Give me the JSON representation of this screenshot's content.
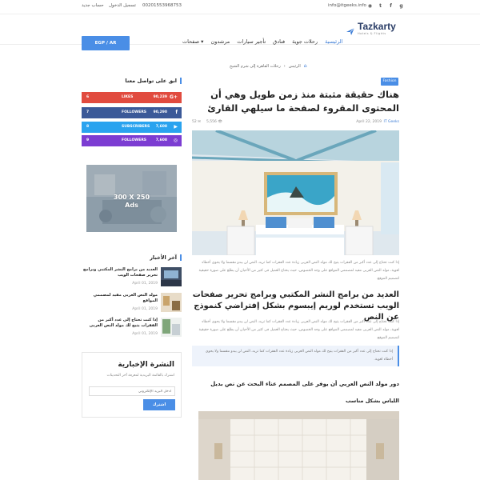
{
  "topbar": {
    "email": "info@itgeeks.info",
    "phone": "00201553968753",
    "login": "تسجيل الدخول",
    "register": "حساب جديد",
    "social_icons": [
      "instagram-icon",
      "twitter-icon",
      "facebook-icon",
      "google-plus-icon"
    ]
  },
  "header": {
    "logo_text": "Tazkarty",
    "logo_sub": "Hotels & Flights",
    "nav": [
      {
        "label": "الرئيسية",
        "active": true
      },
      {
        "label": "رحلات جوية",
        "active": false
      },
      {
        "label": "فنادق",
        "active": false
      },
      {
        "label": "تأجير سيارات",
        "active": false
      },
      {
        "label": "مرشدون",
        "active": false
      },
      {
        "label": "صفحات ▾",
        "active": false
      }
    ],
    "currency_button": "EGP / AR"
  },
  "breadcrumb": {
    "items": [
      "الرئيس",
      "رحلات القاهرة إلى شرم الشيخ"
    ]
  },
  "article": {
    "tag": "Fashion",
    "title": "هناك حقيقة مثبتة منذ زمن طويل وهي أن المحتوى المقروء لصفحة ما سيلهي القارئ",
    "author": "IT Geeks",
    "date": "April 22, 2019",
    "views": "5,556",
    "comments": "52",
    "para1": "إذا كنت تحتاج إلى عدد أكبر من الفقرات يتيح لك مولد النص العربى زيادة عدد الفقرات كما تريد، النص لن يبدو مقسما ولا يحوي أخطاء لغوية، مولد النص العربى مفيد لمصممي المواقع على وجه الخصوص، حيث يحتاج العميل فى كثير من الأحيان أن يطلع على صورة حقيقية لتصميم الموقع.",
    "subtitle": "العديد من برامج النشر المكتبي وبرامج تحرير صفحات الويب تستخدم لوريم إيبسوم بشكل إفتراضي كنموذج عن النص",
    "para2": "إذا كنت تحتاج إلى عدد أكبر من الفقرات يتيح لك مولد النص العربى زيادة عدد الفقرات كما تريد، النص لن يبدو مقسما ولا يحوي أخطاء لغوية، مولد النص العربى مفيد لمصممي المواقع على وجه الخصوص، حيث يحتاج العميل فى كثير من الأحيان أن يطلع على صورة حقيقية لتصميم الموقع.",
    "quote": "إذا كنت تحتاج إلى عدد أكبر من الفقرات يتيح لك مولد النص العربى زيادة عدد الفقرات كما تريد، النص لن يبدو مقسما ولا يحوي أخطاء لغوية.",
    "heading3": "دور مولد النص العربي أن يوفر على المصمم عناء البحث عن نص بديل",
    "heading4": "اللباس بشكل مناسب"
  },
  "sidebar": {
    "social_title": "ابق على تواصل معنا",
    "social": [
      {
        "icon": "G+",
        "count": "90,239",
        "label": "LIKES",
        "num": "6"
      },
      {
        "icon": "f",
        "count": "90,290",
        "label": "FOLLOWERS",
        "num": "7"
      },
      {
        "icon": "▶",
        "count": "7,608",
        "label": "SUBSCRIBERS",
        "num": "8"
      },
      {
        "icon": "◎",
        "count": "7,608",
        "label": "FOLLOWERS",
        "num": "9"
      }
    ],
    "ad_label": "300 X 250",
    "ad_sub": "Ads",
    "latest_title": "آخر الأخبار",
    "latest": [
      {
        "title": "العديد من برامج النشر المكتبي وبرامج تحرير صفحات الويب",
        "date": "April 01, 2019"
      },
      {
        "title": "مولد النص العربى مفيد لمصممي المواقع",
        "date": "April 01, 2019"
      },
      {
        "title": "إذا كنت تحتاج إلى عدد أكبر من الفقرات يتيح لك مولد النص العربى",
        "date": "April 01, 2019"
      }
    ],
    "newsletter": {
      "title": "النشرة الإخبارية",
      "desc": "اشترك بالقائمة البريدية لمعرفة آخر التحديثات",
      "placeholder": "ادخل البريد الإلكتروني",
      "button": "اشترك"
    }
  },
  "colors": {
    "accent": "#4a8ee6",
    "google": "#e14b3f",
    "facebook": "#3b5998",
    "youtube": "#2aa3ef",
    "instagram": "#7c3dd2"
  }
}
